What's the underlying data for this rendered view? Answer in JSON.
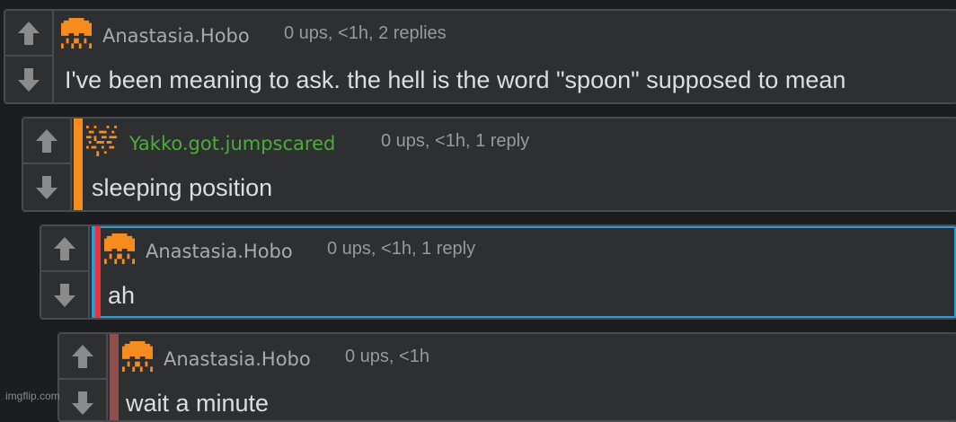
{
  "comments": [
    {
      "username": "Anastasia.Hobo",
      "meta": "0 ups, <1h, 2 replies",
      "text": "I've been meaning to ask. the hell is the word \"spoon\" supposed to mean"
    },
    {
      "username": "Yakko.got.jumpscared",
      "meta": "0 ups, <1h, 1 reply",
      "text": "sleeping position"
    },
    {
      "username": "Anastasia.Hobo",
      "meta": "0 ups, <1h, 1 reply",
      "text": "ah"
    },
    {
      "username": "Anastasia.Hobo",
      "meta": "0 ups, <1h",
      "text": "wait a minute"
    }
  ],
  "icons": {
    "upvote": "arrow-up-icon",
    "downvote": "arrow-down-icon"
  },
  "colors": {
    "accent_orange": "#f68b1e",
    "username_green": "#4cad3c",
    "stripe_red": "#e8353b",
    "selected_border_blue": "#2c9ad6"
  },
  "watermark": "imgflip.com"
}
